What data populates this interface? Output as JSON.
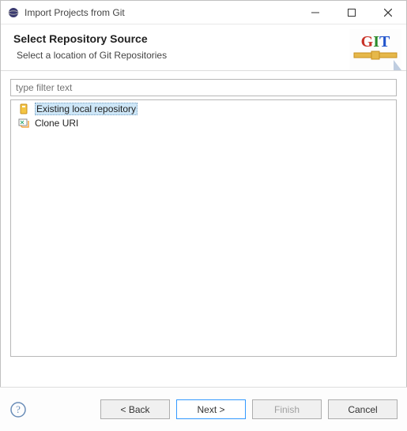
{
  "titlebar": {
    "title": "Import Projects from Git"
  },
  "header": {
    "heading": "Select Repository Source",
    "sub": "Select a location of Git Repositories"
  },
  "filter": {
    "placeholder": "type filter text"
  },
  "options": [
    {
      "label": "Existing local repository",
      "icon": "repo-icon",
      "selected": true
    },
    {
      "label": "Clone URI",
      "icon": "clone-icon",
      "selected": false
    }
  ],
  "buttons": {
    "back": "< Back",
    "next": "Next >",
    "finish": "Finish",
    "cancel": "Cancel"
  },
  "git_logo_text": "GIT"
}
